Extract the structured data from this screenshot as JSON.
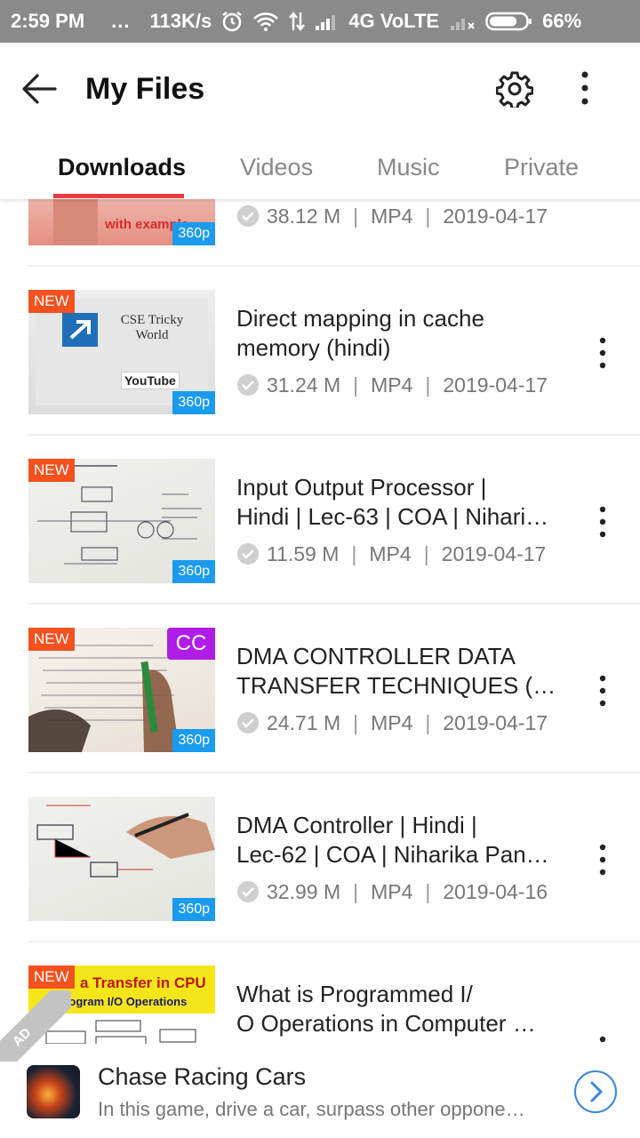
{
  "status_bar": {
    "time": "2:59 PM",
    "dots": "...",
    "speed": "113K/s",
    "network": "4G VoLTE",
    "battery": "66%"
  },
  "app_bar": {
    "title": "My Files",
    "back_icon": "arrow-left-icon",
    "settings_icon": "gear-icon",
    "more_icon": "more-vertical-icon"
  },
  "tabs": [
    {
      "label": "Downloads",
      "active": true
    },
    {
      "label": "Videos",
      "active": false
    },
    {
      "label": "Music",
      "active": false
    },
    {
      "label": "Private",
      "active": false
    }
  ],
  "accent_color": "#e83b3b",
  "items": [
    {
      "title_lines": [
        "",
        ""
      ],
      "thumb_text": "with example",
      "new": false,
      "cc": false,
      "resolution": "360p",
      "size": "38.12 M",
      "format": "MP4",
      "date": "2019-04-17"
    },
    {
      "title_lines": [
        "Direct mapping in cache",
        "memory (hindi)"
      ],
      "thumb_text": "CSE Tricky World",
      "thumb_sub": "YouTube",
      "new": true,
      "cc": false,
      "resolution": "360p",
      "size": "31.24 M",
      "format": "MP4",
      "date": "2019-04-17"
    },
    {
      "title_lines": [
        "Input Output Processor  |",
        "Hindi | Lec-63 | COA | Nihari…"
      ],
      "new": true,
      "cc": false,
      "resolution": "360p",
      "size": "11.59 M",
      "format": "MP4",
      "date": "2019-04-17"
    },
    {
      "title_lines": [
        "DMA CONTROLLER DATA",
        "TRANSFER TECHNIQUES (…"
      ],
      "new": true,
      "cc": true,
      "resolution": "360p",
      "size": "24.71 M",
      "format": "MP4",
      "date": "2019-04-17"
    },
    {
      "title_lines": [
        "DMA Controller | Hindi |",
        "Lec-62 | COA | Niharika Pan…"
      ],
      "new": false,
      "cc": false,
      "resolution": "360p",
      "size": "32.99 M",
      "format": "MP4",
      "date": "2019-04-16"
    },
    {
      "title_lines": [
        "What is Programmed I/",
        "O Operations in Computer …"
      ],
      "thumb_text": "a Transfer in CPU",
      "thumb_sub": "Program I/O Operations",
      "new": true,
      "cc": false
    }
  ],
  "labels": {
    "new": "NEW",
    "cc": "CC"
  },
  "ad": {
    "corner": "AD",
    "title": "Chase Racing Cars",
    "description": "In this game, drive a car, surpass other oppone…"
  }
}
